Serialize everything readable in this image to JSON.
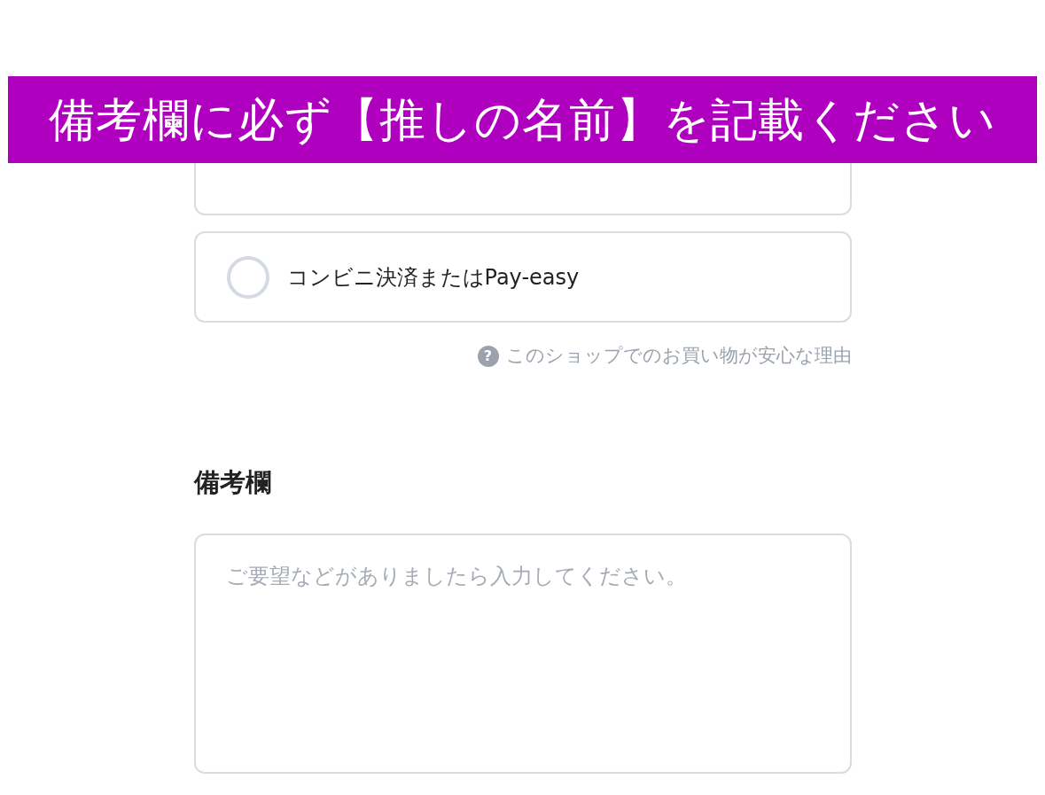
{
  "banner": {
    "text": "備考欄に必ず【推しの名前】を記載ください"
  },
  "payment_options": [
    {
      "kind": "partial",
      "selected": false
    },
    {
      "kind": "full",
      "label": "コンビニ決済またはPay-easy",
      "selected": false
    }
  ],
  "help_link": {
    "icon": "?",
    "text": "このショップでのお買い物が安心な理由"
  },
  "notes": {
    "heading": "備考欄",
    "placeholder": "ご要望などがありましたら入力してください。"
  }
}
